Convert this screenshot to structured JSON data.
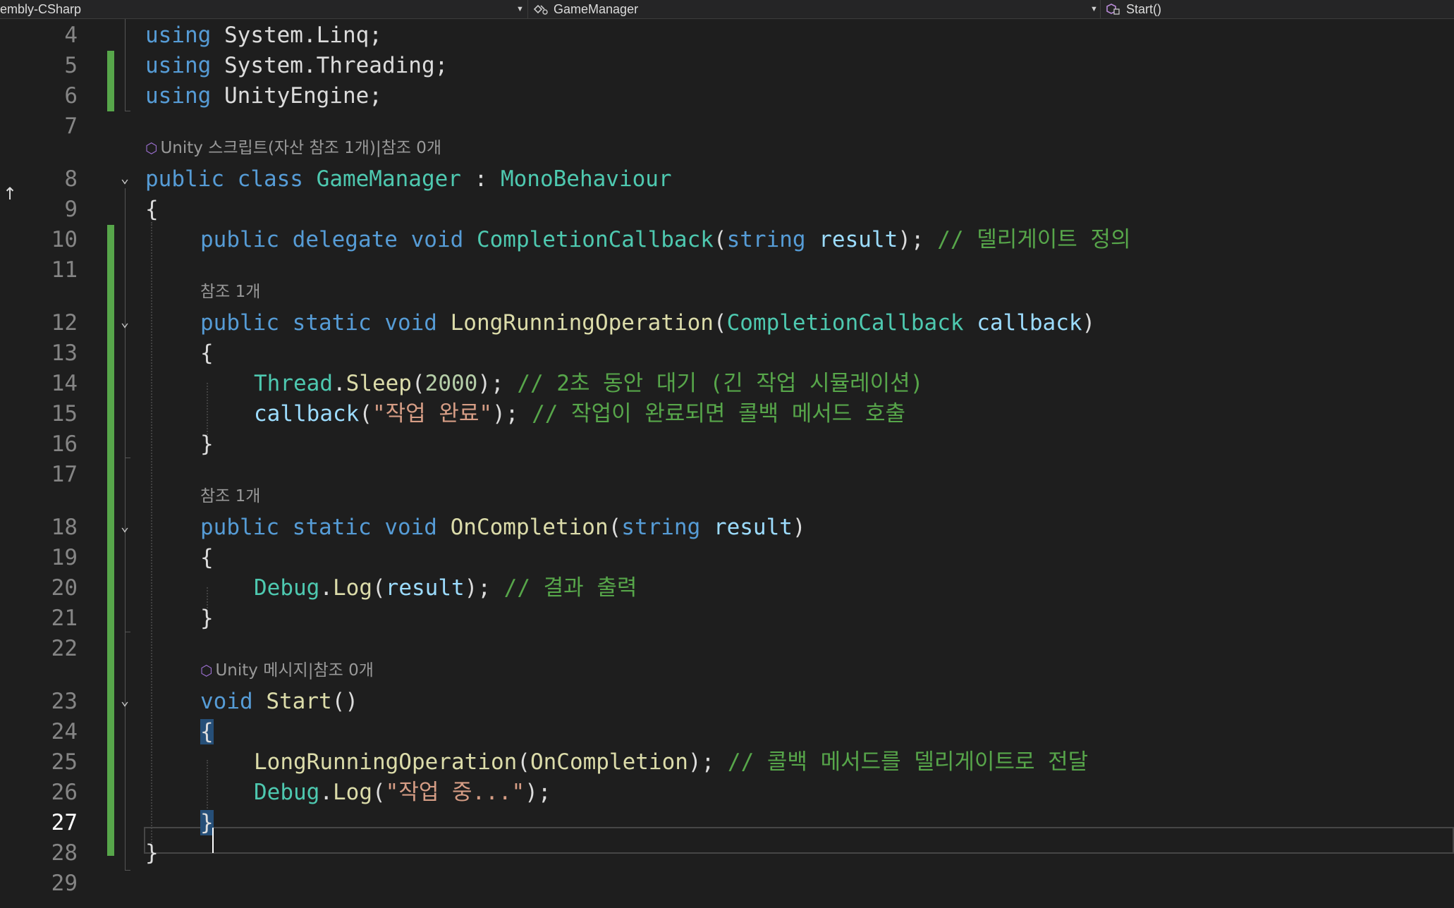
{
  "navigation_bar": {
    "project": "embly-CSharp",
    "type": "GameManager",
    "member": "Start()"
  },
  "code_lenses": {
    "class_lens": "Unity 스크립트(자산 참조 1개)|참조 0개",
    "long_running_refs": "참조 1개",
    "on_completion_refs": "참조 1개",
    "start_lens": "Unity 메시지|참조 0개"
  },
  "line_numbers": [
    "4",
    "5",
    "6",
    "7",
    "8",
    "9",
    "10",
    "11",
    "12",
    "13",
    "14",
    "15",
    "16",
    "17",
    "18",
    "19",
    "20",
    "21",
    "22",
    "23",
    "24",
    "25",
    "26",
    "27",
    "28",
    "29"
  ],
  "current_line": "27",
  "code": {
    "l4": {
      "kw": "using",
      "rest": " System.Linq;"
    },
    "l5": {
      "kw": "using",
      "rest": " System.Threading;"
    },
    "l6": {
      "kw": "using",
      "rest": " UnityEngine;"
    },
    "l8": {
      "kw1": "public",
      "kw2": "class",
      "cls": "GameManager",
      "sep": " : ",
      "base": "MonoBehaviour"
    },
    "l9": "{",
    "l10": {
      "kw1": "public",
      "kw2": "delegate",
      "kw3": "void",
      "name": "CompletionCallback",
      "p1": "(",
      "ptype": "string",
      "pname": "result",
      "p2": ");",
      "comment": "// 델리게이트 정의"
    },
    "l12": {
      "kw1": "public",
      "kw2": "static",
      "kw3": "void",
      "name": "LongRunningOperation",
      "p1": "(",
      "ptype": "CompletionCallback",
      "pname": "callback",
      "p2": ")"
    },
    "l13": "{",
    "l14": {
      "cls": "Thread",
      "dot": ".",
      "fn": "Sleep",
      "p1": "(",
      "num": "2000",
      "p2": ");",
      "comment": "// 2초 동안 대기 (긴 작업 시뮬레이션)"
    },
    "l15": {
      "param": "callback",
      "p1": "(",
      "str": "\"작업 완료\"",
      "p2": ");",
      "comment": "// 작업이 완료되면 콜백 메서드 호출"
    },
    "l16": "}",
    "l18": {
      "kw1": "public",
      "kw2": "static",
      "kw3": "void",
      "name": "OnCompletion",
      "p1": "(",
      "ptype": "string",
      "pname": "result",
      "p2": ")"
    },
    "l19": "{",
    "l20": {
      "cls": "Debug",
      "dot": ".",
      "fn": "Log",
      "p1": "(",
      "param": "result",
      "p2": ");",
      "comment": "// 결과 출력"
    },
    "l21": "}",
    "l23": {
      "kw": "void",
      "name": "Start",
      "p": "()"
    },
    "l24": "{",
    "l25": {
      "fn": "LongRunningOperation",
      "p1": "(",
      "arg": "OnCompletion",
      "p2": ");",
      "comment": "// 콜백 메서드를 델리게이트로 전달"
    },
    "l26": {
      "cls": "Debug",
      "dot": ".",
      "fn": "Log",
      "p1": "(",
      "str": "\"작업 중...\"",
      "p2": ");"
    },
    "l27": "}",
    "l28": "}"
  },
  "colors": {
    "background": "#1e1e1e",
    "keyword": "#569cd6",
    "type": "#4ec9b0",
    "method": "#dcdcaa",
    "parameter": "#9cdcfe",
    "string": "#d69d85",
    "number": "#b5cea8",
    "comment": "#57a64a",
    "change_marker": "#57a64a"
  },
  "icons": [
    "dropdown-arrow-icon",
    "class-icon",
    "method-icon",
    "unity-icon",
    "collapse-chevron-icon",
    "scroll-up-arrow-icon"
  ]
}
